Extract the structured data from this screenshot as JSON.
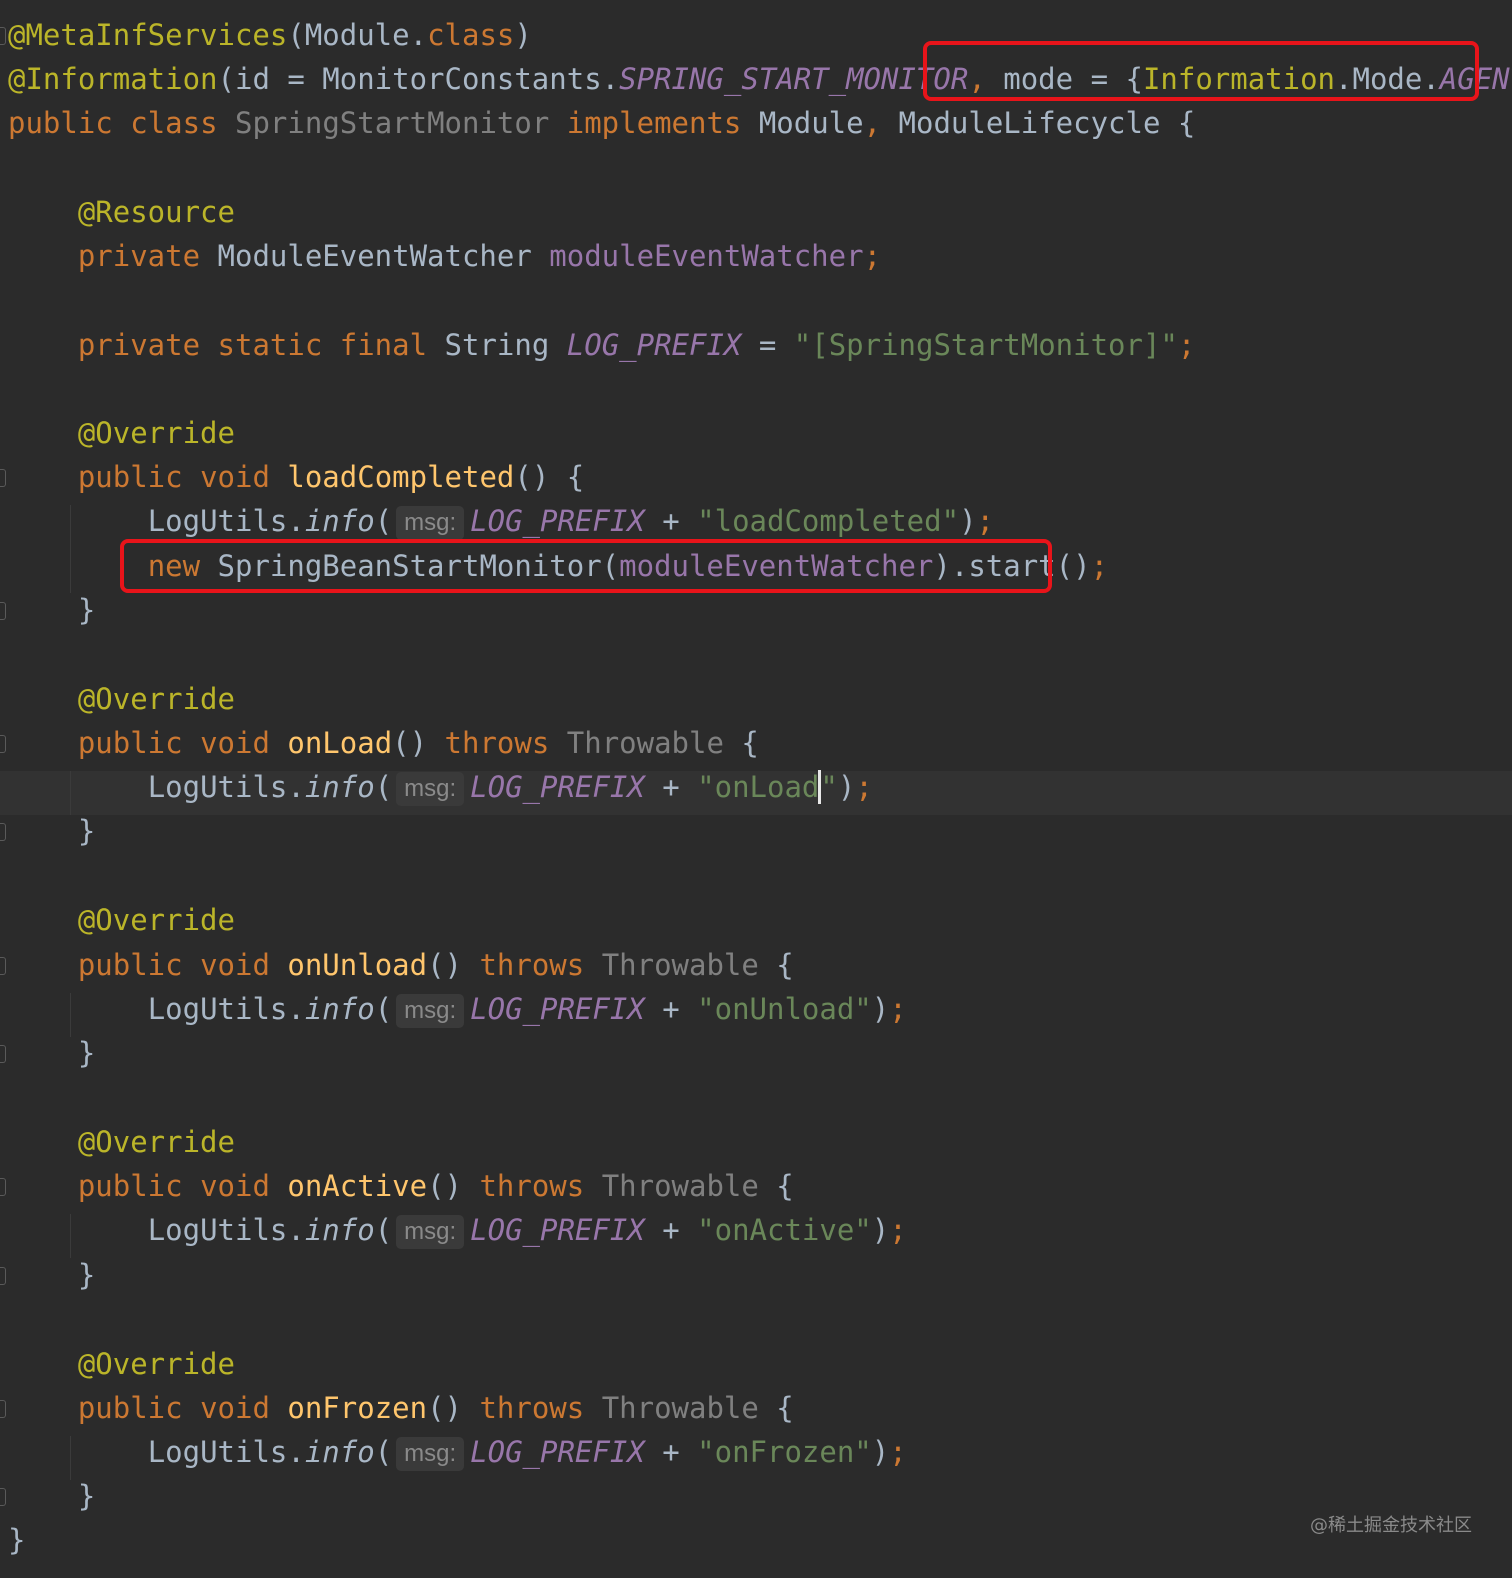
{
  "code": {
    "ann_meta_inf": "@MetaInfServices",
    "module": "Module",
    "class_kw": "class",
    "ann_information": "@Information",
    "id_attr": "id",
    "monitor_constants": "MonitorConstants",
    "spring_start_monitor": "SPRING_START_MONITOR",
    "mode_attr": "mode",
    "information": "Information",
    "mode_enum": "Mode",
    "agent": "AGENT",
    "public_kw": "public",
    "class_name": "SpringStartMonitor",
    "implements_kw": "implements",
    "module_lifecycle": "ModuleLifecycle",
    "ann_resource": "@Resource",
    "private_kw": "private",
    "watcher_type": "ModuleEventWatcher",
    "watcher_field": "moduleEventWatcher",
    "static_kw": "static",
    "final_kw": "final",
    "string_type": "String",
    "log_prefix": "LOG_PREFIX",
    "log_prefix_value": "\"[SpringStartMonitor]\"",
    "ann_override": "@Override",
    "void_kw": "void",
    "throws_kw": "throws",
    "throwable": "Throwable",
    "log_utils": "LogUtils",
    "info": "info",
    "hint_msg": "msg:",
    "new_kw": "new",
    "bean_monitor": "SpringBeanStartMonitor",
    "start": "start",
    "methods": [
      {
        "name": "loadCompleted",
        "message": "\"loadCompleted\""
      },
      {
        "name": "onLoad",
        "message_before_caret": "\"onLoad",
        "message_after_caret": "\""
      },
      {
        "name": "onUnload",
        "message": "\"onUnload\""
      },
      {
        "name": "onActive",
        "message": "\"onActive\""
      },
      {
        "name": "onFrozen",
        "message": "\"onFrozen\""
      }
    ]
  },
  "watermark": "@稀土掘金技术社区",
  "colors": {
    "background": "#2b2b2b",
    "keyword": "#cc7832",
    "annotation": "#bbb529",
    "method_declaration": "#ffc66d",
    "field": "#9876aa",
    "string": "#6a8759",
    "default_text": "#a9b7c6",
    "highlight_box": "#e8141a"
  }
}
